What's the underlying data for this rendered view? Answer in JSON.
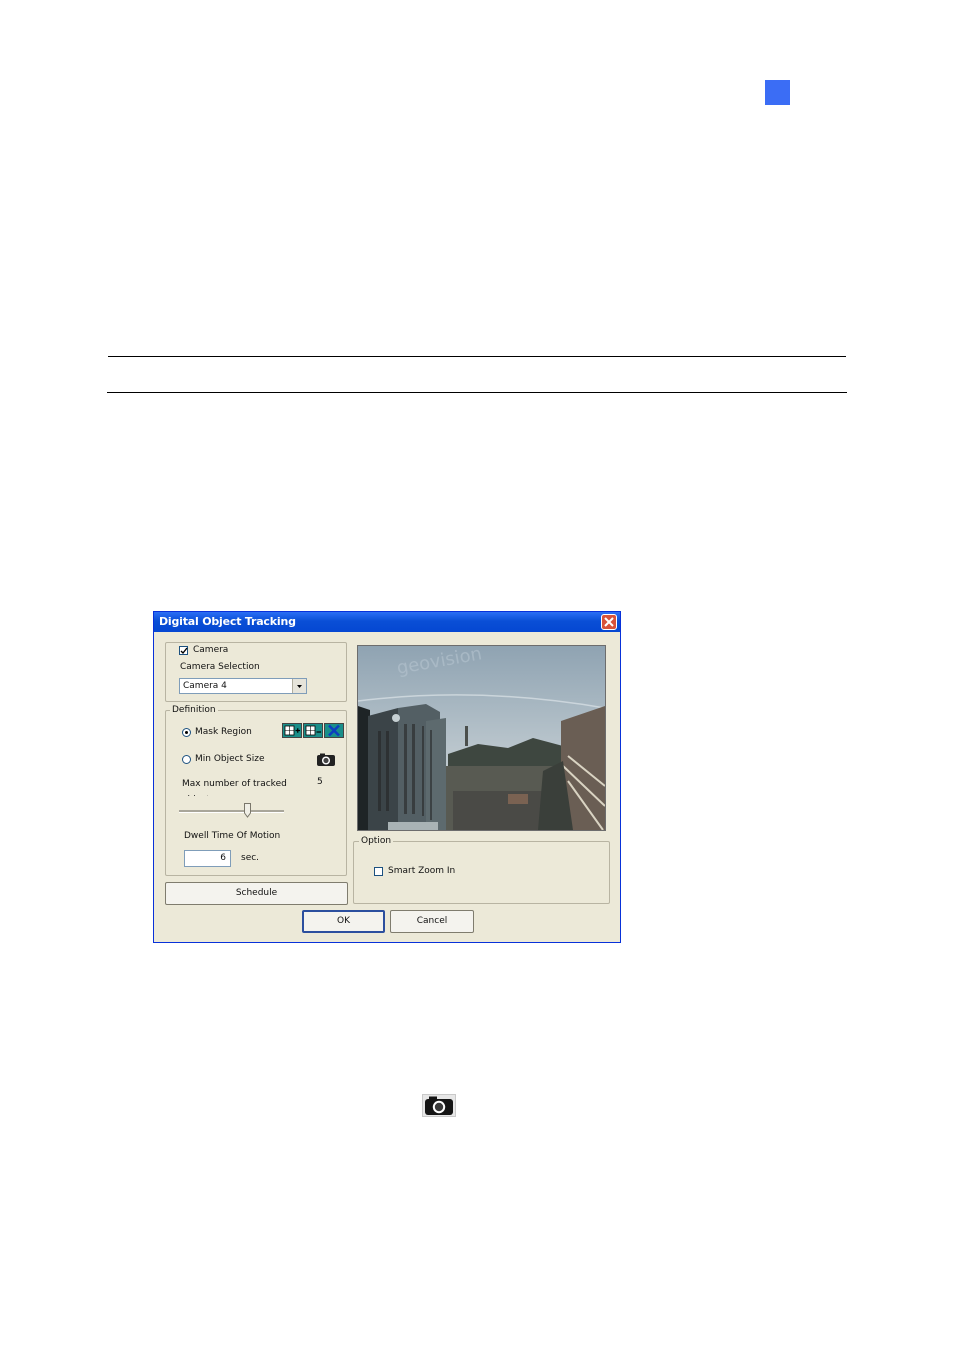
{
  "dialog": {
    "title": "Digital Object Tracking",
    "camera": {
      "checkbox_label": "Camera",
      "checked": true,
      "selection_label": "Camera Selection",
      "selected": "Camera 4"
    },
    "definition": {
      "group_label": "Definition",
      "mask_region_label": "Mask Region",
      "min_object_size_label": "Min Object Size",
      "max_tracked_label_line1": "Max number of tracked",
      "max_tracked_label_line2": "objects",
      "max_tracked_value": "5",
      "slider_value": 5,
      "dwell_label": "Dwell Time Of Motion",
      "dwell_value": "6",
      "dwell_unit": "sec.",
      "icons": [
        "add-region-icon",
        "remove-region-icon",
        "clear-region-icon",
        "camera-icon"
      ]
    },
    "schedule_label": "Schedule",
    "option": {
      "group_label": "Option",
      "smart_zoom_label": "Smart Zoom In",
      "smart_zoom_checked": false
    },
    "ok_label": "OK",
    "cancel_label": "Cancel"
  },
  "colors": {
    "accent_square": "#3b6df5",
    "titlebar": "#0a4fd6",
    "dialog_bg": "#ece9d8"
  }
}
